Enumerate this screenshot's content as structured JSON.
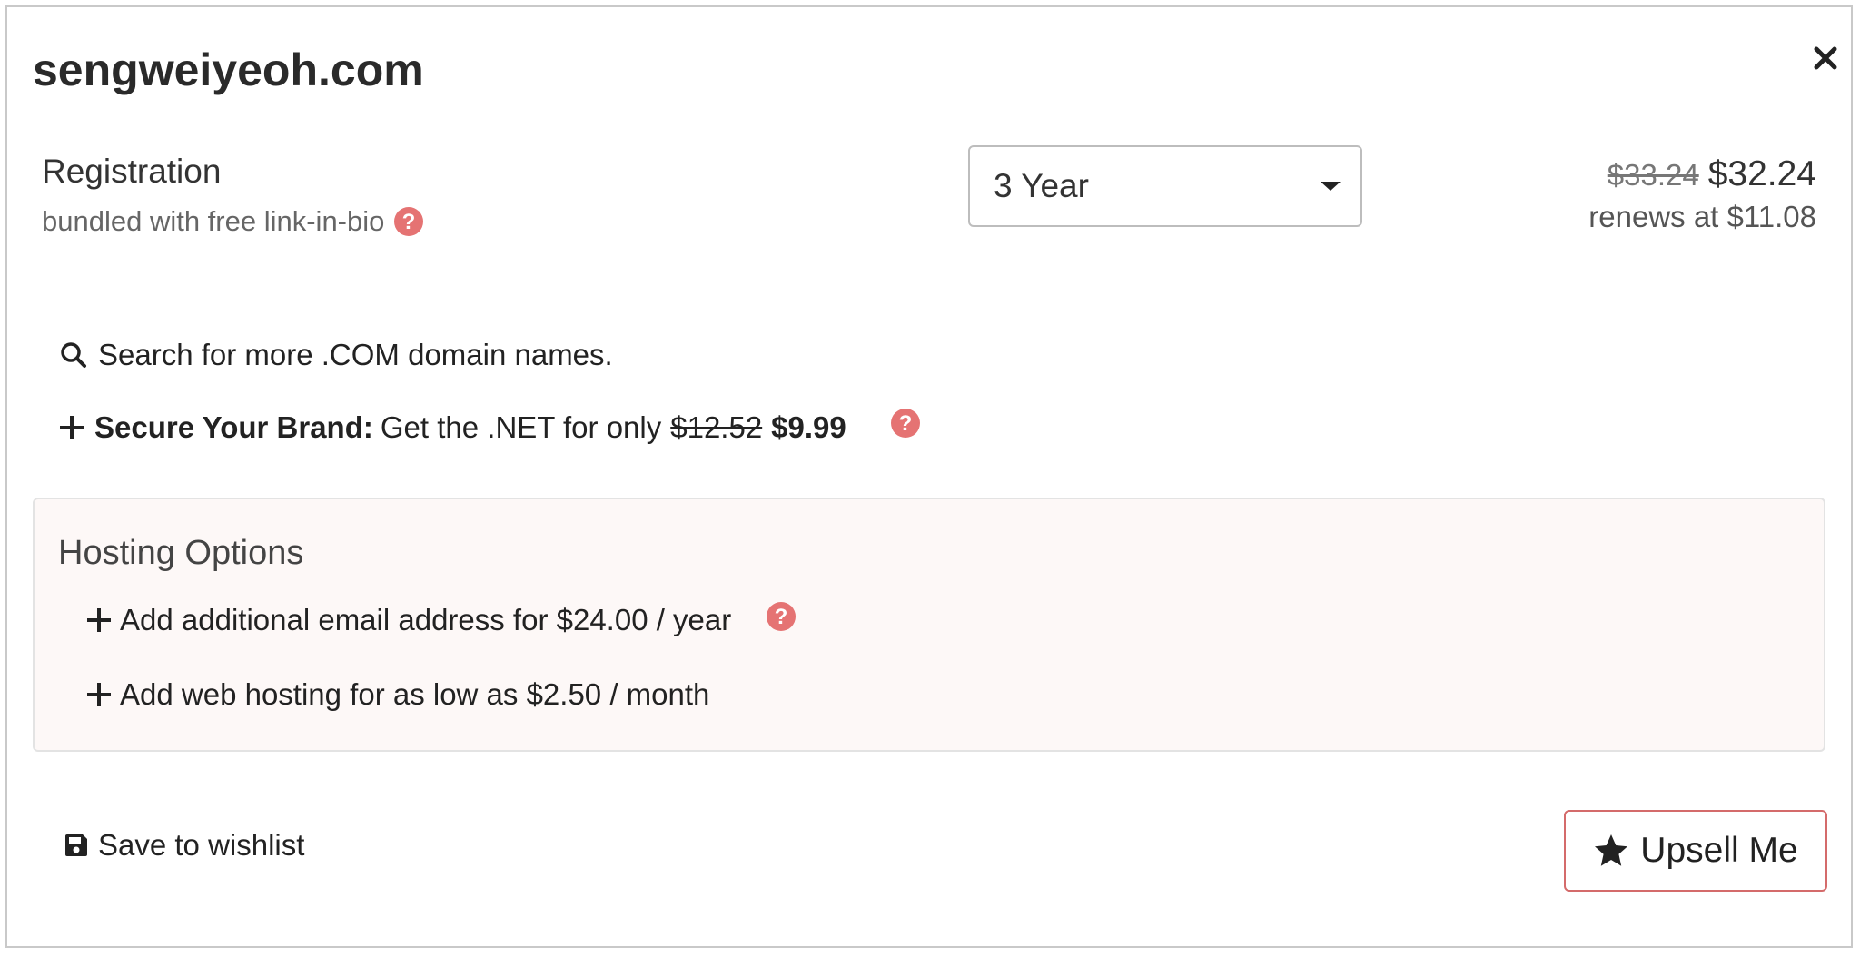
{
  "domain_title": "sengweiyeoh.com",
  "registration": {
    "label": "Registration",
    "sublabel": "bundled with free link-in-bio",
    "term_selected": "3 Year",
    "price_old": "$33.24",
    "price_new": "$32.24",
    "renews": "renews at $11.08"
  },
  "search_more": "Search for more .COM domain names.",
  "secure_brand": {
    "bold": "Secure Your Brand:",
    "text": "Get the .NET for only",
    "old_price": "$12.52",
    "new_price": "$9.99"
  },
  "hosting": {
    "title": "Hosting Options",
    "items": [
      {
        "label": "Add additional email address for $24.00 / year"
      },
      {
        "label": "Add web hosting for as low as $2.50 / month"
      }
    ]
  },
  "wishlist_label": "Save to wishlist",
  "upsell_label": "Upsell Me",
  "colors": {
    "help_icon": "#e57373",
    "upsell_border": "#d46b6b",
    "hosting_bg": "#fdf8f7"
  },
  "icons": [
    "close-icon",
    "help-icon",
    "search-icon",
    "plus-icon",
    "save-icon",
    "star-icon"
  ]
}
